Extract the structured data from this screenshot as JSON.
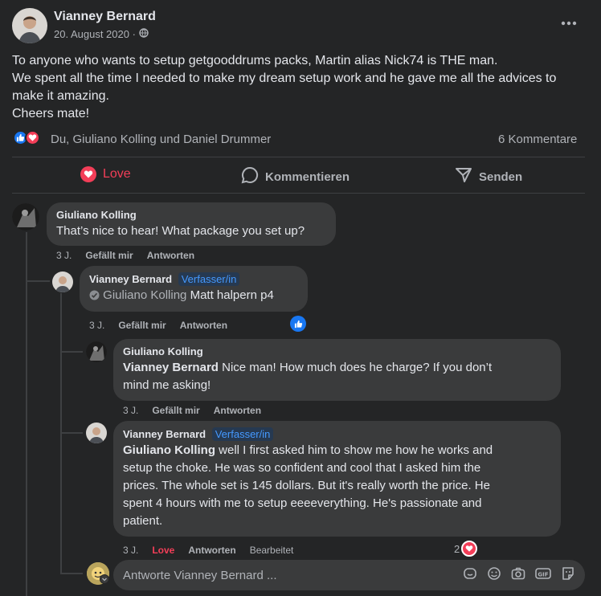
{
  "post": {
    "author": "Vianney Bernard",
    "date": "20. August 2020 ·",
    "body_lines": [
      "To anyone who wants to setup getgooddrums packs, Martin alias Nick74 is THE man.",
      "We spent all the time I needed to make my dream setup work and he gave me all the advices to",
      "make it amazing.",
      "Cheers mate!"
    ],
    "reactions_text": "Du, Giuliano Kolling und Daniel Drummer",
    "comments_count": "6 Kommentare",
    "more_icon": "more-horizontal-icon",
    "privacy_icon": "globe-icon"
  },
  "actions": {
    "love": "Love",
    "comment": "Kommentieren",
    "send": "Senden"
  },
  "comments": [
    {
      "author": "Giuliano Kolling",
      "text": "That’s nice to hear! What package you set up?",
      "time": "3 J.",
      "like": "Gefällt mir",
      "reply": "Antworten"
    },
    {
      "author": "Vianney Bernard",
      "badge": "Verfasser/in",
      "mention": "Giuliano Kolling",
      "text": "Matt halpern p4",
      "time": "3 J.",
      "like": "Gefällt mir",
      "reply": "Antworten"
    },
    {
      "author": "Giuliano Kolling",
      "mention": "Vianney Bernard",
      "text_line1": "Nice man! How much does he charge? If you don’t",
      "text_line2": "mind me asking!",
      "time": "3 J.",
      "like": "Gefällt mir",
      "reply": "Antworten"
    },
    {
      "author": "Vianney Bernard",
      "badge": "Verfasser/in",
      "mention": "Giuliano Kolling",
      "text_line1": "well I first asked him to show me how he works and",
      "text_lines": [
        "setup the choke. He was so confident and cool that I asked him the",
        "prices. The whole set is 145 dollars. But it's really worth the price. He",
        "spent 4 hours with me to setup eeeeverything. He's passionate and",
        "patient."
      ],
      "time": "3 J.",
      "love": "Love",
      "reply": "Antworten",
      "edited": "Bearbeitet",
      "reaction_count": "2"
    }
  ],
  "reply_box": {
    "placeholder": "Antworte Vianney Bernard ...",
    "icons": [
      "sticker-face-icon",
      "emoji-icon",
      "camera-icon",
      "gif-icon",
      "sticker-icon"
    ]
  },
  "colors": {
    "background": "#242526",
    "bubble": "#3a3b3c",
    "love": "#f33e58",
    "like_blue": "#1877f2",
    "badge_text": "#4599ff"
  }
}
